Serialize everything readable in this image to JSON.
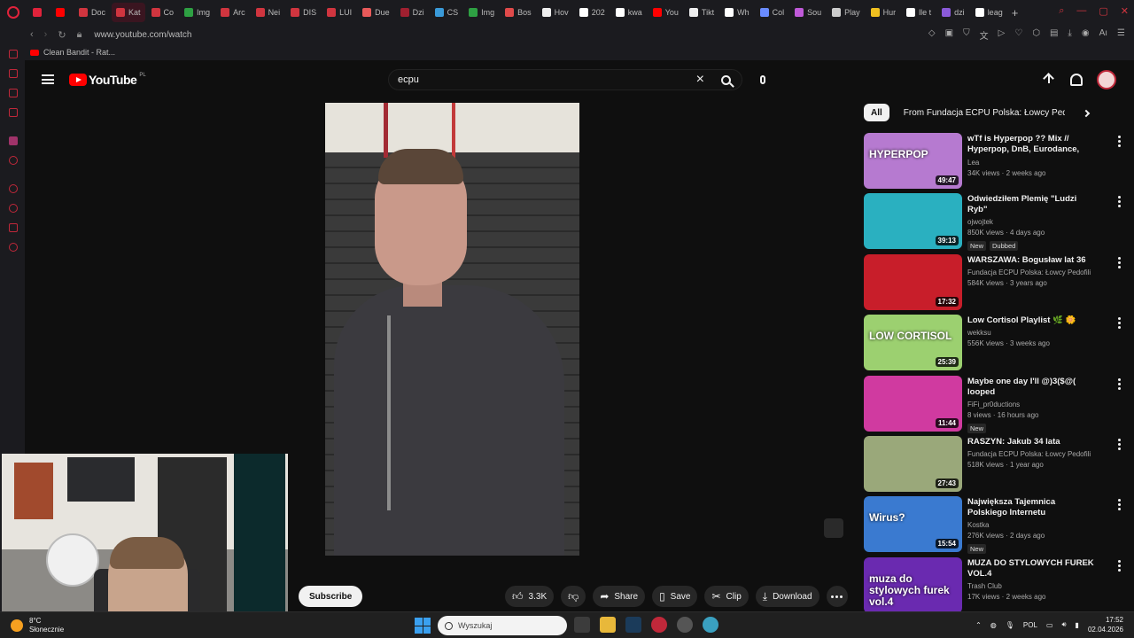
{
  "browser": {
    "tabs": [
      {
        "label": "",
        "color": "#e0233b"
      },
      {
        "label": "",
        "color": "#ff0000"
      },
      {
        "label": "Doc",
        "color": "#d0353f"
      },
      {
        "label": "Kat",
        "color": "#d0353f"
      },
      {
        "label": "Co",
        "color": "#d0353f"
      },
      {
        "label": "Img",
        "color": "#2ea043"
      },
      {
        "label": "Arc",
        "color": "#d0353f"
      },
      {
        "label": "Nei",
        "color": "#d0353f"
      },
      {
        "label": "DIS",
        "color": "#d0353f"
      },
      {
        "label": "LUI",
        "color": "#d0353f"
      },
      {
        "label": "Due",
        "color": "#e85a5a"
      },
      {
        "label": "Dzi",
        "color": "#a02030"
      },
      {
        "label": "CS",
        "color": "#3a9ad9"
      },
      {
        "label": "Img",
        "color": "#2ea043"
      },
      {
        "label": "Bos",
        "color": "#e04a4a"
      },
      {
        "label": "Hov",
        "color": "#eeeeee"
      },
      {
        "label": "202",
        "color": "#ffffff"
      },
      {
        "label": "kwa",
        "color": "#ffffff"
      },
      {
        "label": "You",
        "color": "#ff0000"
      },
      {
        "label": "Tikt",
        "color": "#eeeeee"
      },
      {
        "label": "Wh",
        "color": "#ffffff"
      },
      {
        "label": "Col",
        "color": "#6a8cff"
      },
      {
        "label": "Sou",
        "color": "#c05ad9"
      },
      {
        "label": "Play",
        "color": "#cccccc"
      },
      {
        "label": "Hur",
        "color": "#f0c020"
      },
      {
        "label": "lle t",
        "color": "#ffffff"
      },
      {
        "label": "dzi",
        "color": "#8a5ad9"
      },
      {
        "label": "leag",
        "color": "#ffffff"
      }
    ],
    "new_tab": "+",
    "url": "www.youtube.com/watch",
    "bookmark": "Clean Bandit - Rat..."
  },
  "youtube": {
    "logo_text": "YouTube",
    "country": "PL",
    "search_value": "ecpu",
    "chips": [
      "All",
      "From Fundacja ECPU Polska: Łowcy Pedofili"
    ],
    "subscribe": "Subscribe",
    "actions": {
      "likes": "3.3K",
      "share": "Share",
      "save": "Save",
      "clip": "Clip",
      "download": "Download"
    },
    "recommendations": [
      {
        "title": "wTf is Hyperpop ?? Mix // Hyperpop, DnB, Eurodance, J-...",
        "channel": "Lea",
        "meta": "34K views · 2 weeks ago",
        "duration": "49:47",
        "badges": [],
        "thumb": "#b67ad0",
        "thumb_text": "HYPERPOP"
      },
      {
        "title": "Odwiedziłem Plemię \"Ludzi Ryb\"",
        "channel": "ojwojtek",
        "meta": "850K views · 4 days ago",
        "duration": "39:13",
        "badges": [
          "New",
          "Dubbed"
        ],
        "thumb": "#2ab0c0",
        "thumb_text": ""
      },
      {
        "title": "WARSZAWA: Bogusław lat 36",
        "channel": "Fundacja ECPU Polska: Łowcy Pedofili",
        "meta": "584K views · 3 years ago",
        "duration": "17:32",
        "badges": [],
        "thumb": "#c81e2a",
        "thumb_text": ""
      },
      {
        "title": "Low Cortisol Playlist 🌿 🌼",
        "channel": "wekksu",
        "meta": "556K views · 3 weeks ago",
        "duration": "25:39",
        "badges": [],
        "thumb": "#9cd070",
        "thumb_text": "LOW CORTISOL"
      },
      {
        "title": "Maybe one day I'll @)3($@( looped",
        "channel": "FiFi_pr0ductions",
        "meta": "8 views · 16 hours ago",
        "duration": "11:44",
        "badges": [
          "New"
        ],
        "thumb": "#d03aa0",
        "thumb_text": ""
      },
      {
        "title": "RASZYN: Jakub 34 lata",
        "channel": "Fundacja ECPU Polska: Łowcy Pedofili",
        "meta": "518K views · 1 year ago",
        "duration": "27:43",
        "badges": [],
        "thumb": "#9aa87a",
        "thumb_text": ""
      },
      {
        "title": "Największa Tajemnica Polskiego Internetu",
        "channel": "Kostka",
        "meta": "276K views · 2 days ago",
        "duration": "15:54",
        "badges": [
          "New"
        ],
        "thumb": "#3a7ad0",
        "thumb_text": "Wirus?"
      },
      {
        "title": "MUZA DO STYLOWYCH FUREK VOL.4",
        "channel": "Trash Club",
        "meta": "17K views · 2 weeks ago",
        "duration": "",
        "badges": [],
        "thumb": "#6a2ab0",
        "thumb_text": "muza do stylowych furek vol.4"
      }
    ]
  },
  "taskbar": {
    "weather_temp": "8°C",
    "weather_desc": "Słonecznie",
    "search_placeholder": "Wyszukaj",
    "lang": "POL",
    "time": "17:52",
    "date": "02.04.2026"
  }
}
